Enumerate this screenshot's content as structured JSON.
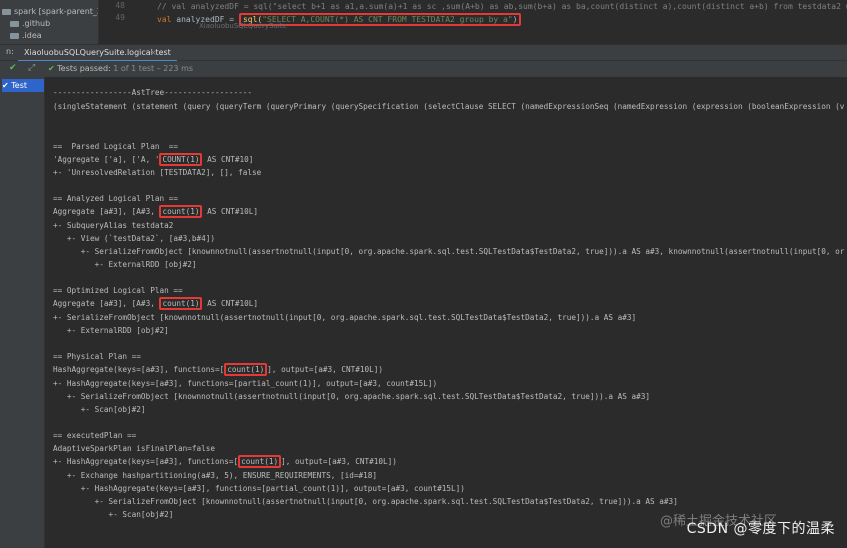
{
  "project": {
    "items": [
      {
        "label": "spark [spark-parent_2"
      },
      {
        "label": ".github"
      },
      {
        "label": ".idea"
      }
    ]
  },
  "editor": {
    "line_numbers": [
      "48",
      "49"
    ],
    "comment_line": "// val analyzedDF = sql(\"select b+1 as a1,a.sum(a)+1 as sc ,sum(A+b) as ab,sum(b+a) as ba,count(distinct a),count(distinct a+b) from testdata2 where",
    "val_kw": "val",
    "var_name": "analyzedDF",
    "eq": "=",
    "sql_fn": "sql(",
    "sql_str": "\"SELECT A,COUNT(*) AS CNT FROM TESTDATA2 group by a\"",
    "sql_close": ")",
    "breadcrumb": "XiaoluobuSQLQuerySuite"
  },
  "runbar": {
    "run_label": "n:",
    "tab_label": "XiaoluobuSQLQuerySuite.logical test",
    "close": "×"
  },
  "status": {
    "check_icon": "✔",
    "arrow_icon": "⤢",
    "passed": "Tests passed:",
    "detail": "1 of 1 test – 223 ms"
  },
  "tree": {
    "item_label": "✔ Test"
  },
  "console": {
    "l0": "-----------------AstTree-------------------",
    "l1": "(singleStatement (statement (query (queryTerm (queryPrimary (querySpecification (selectClause SELECT (namedExpressionSeq (namedExpression (expression (booleanExpression (v",
    "parsed_header": "==  Parsed Logical Plan  ==",
    "p1_pre": "'Aggregate ['a], ['A, '",
    "p1_box": "COUNT(1)",
    "p1_post": " AS CNT#10]",
    "p2": "+- 'UnresolvedRelation [TESTDATA2], [], false",
    "analyzed_header": "== Analyzed Logical Plan ==",
    "a1_pre": "Aggregate [a#3], [A#3, ",
    "a1_box": "count(1)",
    "a1_post": " AS CNT#10L]",
    "a2": "+- SubqueryAlias testdata2",
    "a3": "   +- View (`testData2`, [a#3,b#4])",
    "a4": "      +- SerializeFromObject [knownnotnull(assertnotnull(input[0, org.apache.spark.sql.test.SQLTestData$TestData2, true])).a AS a#3, knownnotnull(assertnotnull(input[0, or",
    "a5": "         +- ExternalRDD [obj#2]",
    "optimized_header": "== Optimized Logical Plan ==",
    "o1_pre": "Aggregate [a#3], [A#3, ",
    "o1_box": "count(1)",
    "o1_post": " AS CNT#10L]",
    "o2": "+- SerializeFromObject [knownnotnull(assertnotnull(input[0, org.apache.spark.sql.test.SQLTestData$TestData2, true])).a AS a#3]",
    "o3": "   +- ExternalRDD [obj#2]",
    "physical_header": "== Physical Plan ==",
    "ph1_pre": "HashAggregate(keys=[a#3], functions=[",
    "ph1_box": "count(1)",
    "ph1_post": "], output=[a#3, CNT#10L])",
    "ph2": "+- HashAggregate(keys=[a#3], functions=[partial_count(1)], output=[a#3, count#15L])",
    "ph3": "   +- SerializeFromObject [knownnotnull(assertnotnull(input[0, org.apache.spark.sql.test.SQLTestData$TestData2, true])).a AS a#3]",
    "ph4": "      +- Scan[obj#2]",
    "executed_header": "== executedPlan ==",
    "e0": "AdaptiveSparkPlan isFinalPlan=false",
    "e1_pre": "+- HashAggregate(keys=[a#3], functions=[",
    "e1_box": "count(1)",
    "e1_post": "], output=[a#3, CNT#10L])",
    "e2": "   +- Exchange hashpartitioning(a#3, 5), ENSURE_REQUIREMENTS, [id=#18]",
    "e3": "      +- HashAggregate(keys=[a#3], functions=[partial_count(1)], output=[a#3, count#15L])",
    "e4": "         +- SerializeFromObject [knownnotnull(assertnotnull(input[0, org.apache.spark.sql.test.SQLTestData$TestData2, true])).a AS a#3]",
    "e5": "            +- Scan[obj#2]"
  },
  "watermark": {
    "bg_text": "@稀土掘金技术社区",
    "text": "CSDN @零度下的温柔"
  }
}
